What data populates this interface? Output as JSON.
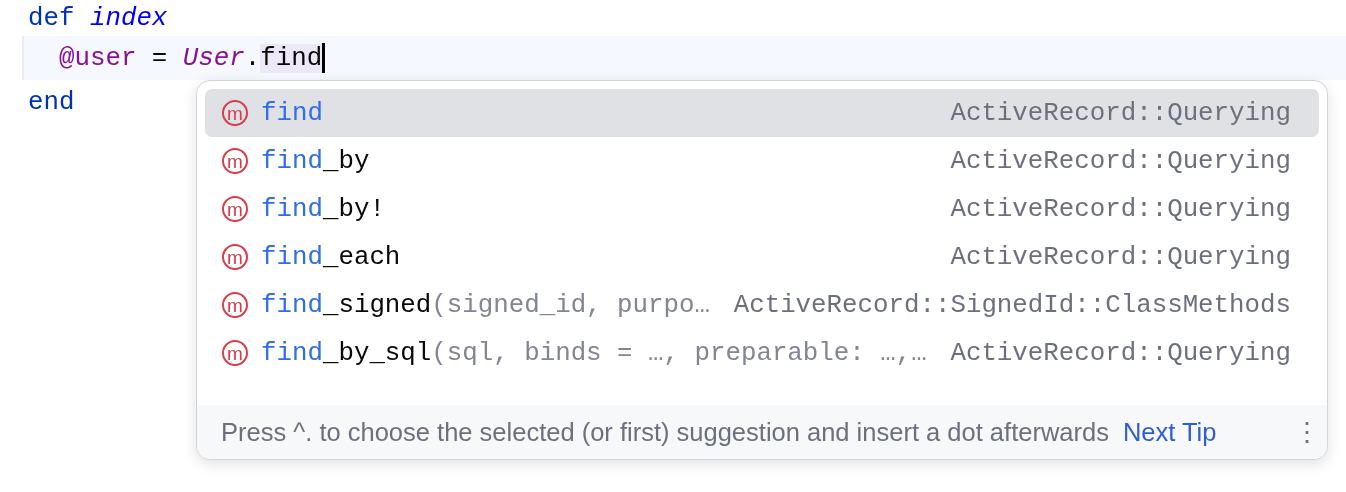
{
  "editor": {
    "lines": [
      {
        "current": false,
        "caret": false,
        "tokens": [
          {
            "kind": "keyword",
            "text": "def"
          },
          {
            "kind": "method",
            "text": " index"
          }
        ]
      },
      {
        "current": true,
        "caret": true,
        "tokens": [
          {
            "kind": "ivar",
            "text": "  @user"
          },
          {
            "kind": "plain",
            "text": " = "
          },
          {
            "kind": "constant",
            "text": "User"
          },
          {
            "kind": "plain",
            "text": "."
          },
          {
            "kind": "match",
            "text": "find"
          }
        ]
      },
      {
        "current": false,
        "caret": false,
        "tokens": [
          {
            "kind": "keyword",
            "text": "end"
          }
        ]
      }
    ]
  },
  "completion": {
    "items": [
      {
        "icon": "m",
        "match": "find",
        "owner": "ActiveRecord::Querying",
        "selected": true
      },
      {
        "icon": "m",
        "match": "find",
        "rest": "_by",
        "owner": "ActiveRecord::Querying",
        "selected": false
      },
      {
        "icon": "m",
        "match": "find",
        "rest": "_by!",
        "owner": "ActiveRecord::Querying",
        "selected": false
      },
      {
        "icon": "m",
        "match": "find",
        "rest": "_each",
        "owner": "ActiveRecord::Querying",
        "selected": false
      },
      {
        "icon": "m",
        "match": "find",
        "rest": "_signed",
        "params": "(signed_id, purpo…",
        "owner": "ActiveRecord::SignedId::ClassMethods",
        "selected": false
      },
      {
        "icon": "m",
        "match": "find",
        "rest": "_by_sql",
        "params": "(sql, binds = …, preparable: …,…",
        "owner": "ActiveRecord::Querying",
        "selected": false
      }
    ],
    "footer": {
      "tip": "Press ^. to choose the selected (or first) suggestion and insert a dot afterwards",
      "link": "Next Tip",
      "menu": "⋮"
    }
  }
}
